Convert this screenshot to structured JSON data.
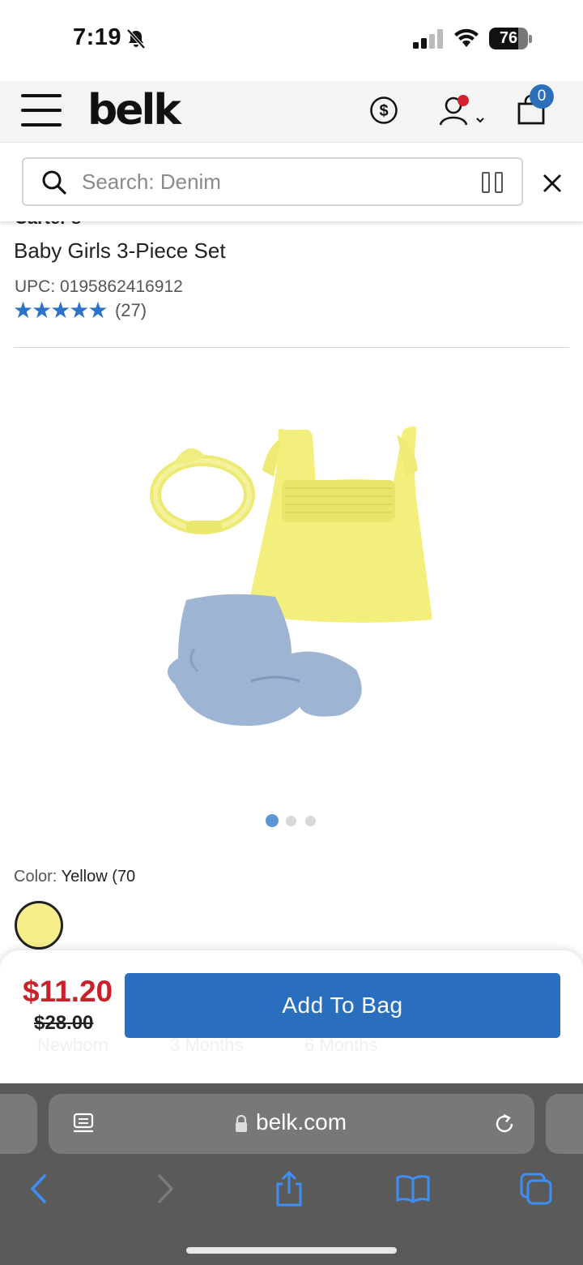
{
  "status_bar": {
    "time": "7:19",
    "battery": "76",
    "battery_level": 0.76
  },
  "header": {
    "brand": "belk",
    "bag_count": "0"
  },
  "search": {
    "placeholder": "Search: Denim"
  },
  "product": {
    "brand": "Carter's",
    "title": "Baby Girls 3-Piece Set",
    "upc": "UPC: 0195862416912",
    "stars": "★★★★★",
    "rating": 5,
    "review_count": "(27)"
  },
  "gallery": {
    "total_images": 3,
    "active_index": 0,
    "active_color": "#5b95d3",
    "inactive_color": "#d8d8d8"
  },
  "color": {
    "label": "Color:",
    "value": "Yellow (70",
    "swatch_hex": "#f6ee8a"
  },
  "purchase": {
    "sale_price": "$11.20",
    "original_price": "$28.00",
    "add_to_bag_label": "Add To Bag",
    "sizes": [
      "Newborn",
      "3 Months",
      "6 Months"
    ]
  },
  "browser": {
    "url": "belk.com"
  },
  "colors": {
    "accent": "#2a6fbd",
    "sale": "#c9202a",
    "stars": "#2a73c9"
  }
}
